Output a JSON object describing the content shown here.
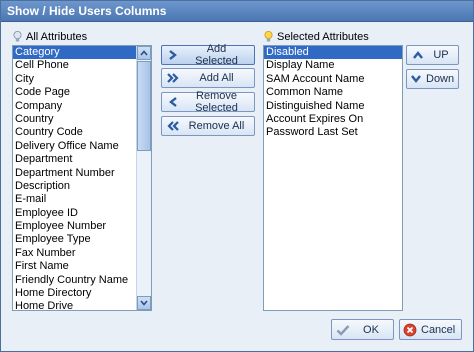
{
  "window": {
    "title": "Show / Hide Users Columns"
  },
  "all_attributes": {
    "label": "All Attributes",
    "items": [
      "Category",
      "Cell Phone",
      "City",
      "Code Page",
      "Company",
      "Country",
      "Country Code",
      "Delivery Office Name",
      "Department",
      "Department Number",
      "Description",
      "E-mail",
      "Employee ID",
      "Employee Number",
      "Employee Type",
      "Fax Number",
      "First Name",
      "Friendly Country Name",
      "Home Directory",
      "Home Drive"
    ],
    "selected_item": "Category"
  },
  "selected_attributes": {
    "label": "Selected Attributes",
    "items": [
      "Disabled",
      "Display Name",
      "SAM Account Name",
      "Common Name",
      "Distinguished Name",
      "Account Expires On",
      "Password Last Set"
    ],
    "selected_item": "Disabled"
  },
  "transfer_buttons": {
    "add_selected": "Add Selected",
    "add_all": "Add All",
    "remove_selected": "Remove Selected",
    "remove_all": "Remove All"
  },
  "order_buttons": {
    "up": "UP",
    "down": "Down"
  },
  "footer": {
    "ok": "OK",
    "cancel": "Cancel"
  },
  "colors": {
    "selection": "#316ac5",
    "titlebar": "#5a84bf",
    "dialog_bg": "#e8eff7"
  }
}
